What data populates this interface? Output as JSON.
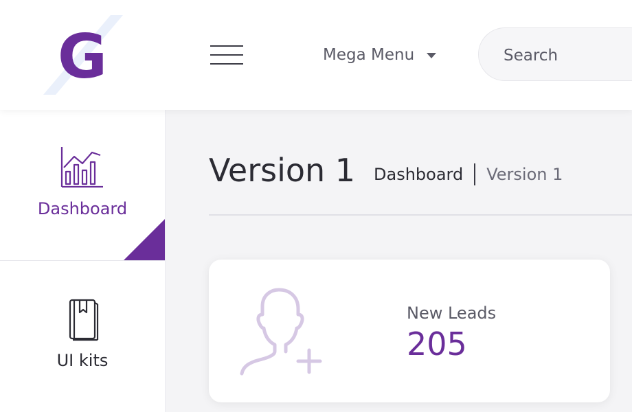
{
  "header": {
    "logo_letter": "G",
    "mega_menu_label": "Mega Menu",
    "search_placeholder": "Search"
  },
  "sidebar": {
    "items": [
      {
        "label": "Dashboard",
        "icon": "bar-chart-icon",
        "active": true
      },
      {
        "label": "UI kits",
        "icon": "book-icon",
        "active": false
      }
    ]
  },
  "main": {
    "page_title": "Version 1",
    "breadcrumb": [
      "Dashboard",
      "Version 1"
    ],
    "card": {
      "label": "New Leads",
      "value": "205",
      "icon": "add-user-icon"
    }
  },
  "colors": {
    "accent": "#6a2e9a",
    "icon_light": "#d6c8e4"
  }
}
